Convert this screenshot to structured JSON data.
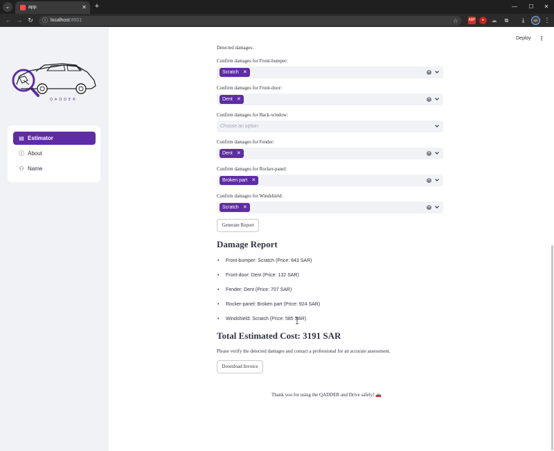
{
  "browser": {
    "tab_title": "app",
    "url_host": "localhost",
    "url_port": ":8501",
    "icons": {
      "tab_menu": "chevron-down-icon",
      "close_tab": "close-icon",
      "new_tab": "plus-icon",
      "back": "arrow-left-icon",
      "forward": "arrow-right-icon",
      "reload": "reload-icon",
      "site_info": "info-icon",
      "bookmark": "star-icon",
      "download": "download-icon",
      "menu": "kebab-icon"
    }
  },
  "app": {
    "deploy_label": "Deploy",
    "logo_text": "QADDER",
    "sidebar": {
      "items": [
        {
          "label": "Estimator",
          "icon": "document-icon",
          "active": true
        },
        {
          "label": "About",
          "icon": "info-icon",
          "active": false
        },
        {
          "label": "Name",
          "icon": "person-icon",
          "active": false
        }
      ]
    },
    "main": {
      "detected_label": "Detected damages:",
      "confirm_groups": [
        {
          "label": "Confirm damages for Front-bumper:",
          "selected": "Scratch"
        },
        {
          "label": "Confirm damages for Front-door:",
          "selected": "Dent"
        },
        {
          "label": "Confirm damages for Back-window:",
          "placeholder": "Choose an option"
        },
        {
          "label": "Confirm damages for Fender:",
          "selected": "Dent"
        },
        {
          "label": "Confirm damages for Rocker-panel:",
          "selected": "Broken part"
        },
        {
          "label": "Confirm damages for Windshield:",
          "selected": "Scratch"
        }
      ],
      "generate_button": "Generate Report",
      "report_title": "Damage Report",
      "report_items": [
        "Front-bumper: Scratch (Price: 843 SAR)",
        "Front-door: Dent (Price: 132 SAR)",
        "Fender: Dent (Price: 707 SAR)",
        "Rocker-panel: Broken part (Price: 924 SAR)",
        "Windshield: Scratch (Price: 585 SAR)"
      ],
      "total_title": "Total Estimated Cost: 3191 SAR",
      "verify_note": "Please verify the detected damages and contact a professional for an accurate assessment.",
      "download_button": "Download Invoice",
      "footer": "Thank you for using the QADDER and Drive safely! 🚗"
    }
  },
  "colors": {
    "accent": "#5e2ca5",
    "sidebar_bg": "#f0f2f6",
    "text": "#31333f"
  }
}
